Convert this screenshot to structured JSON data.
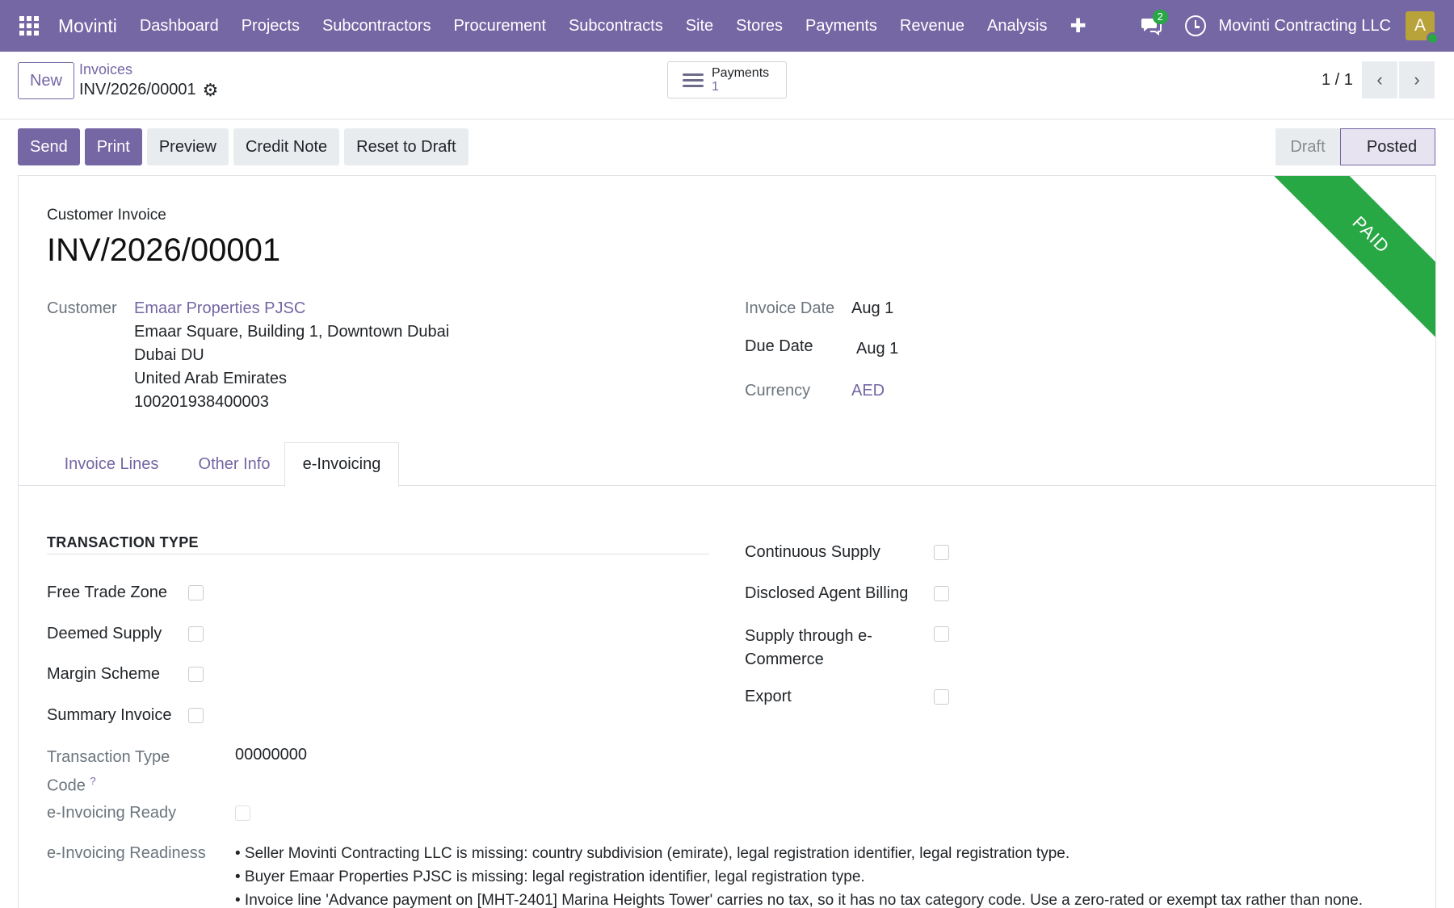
{
  "navbar": {
    "brand": "Movinti",
    "menu": [
      "Dashboard",
      "Projects",
      "Subcontractors",
      "Procurement",
      "Subcontracts",
      "Site",
      "Stores",
      "Payments",
      "Revenue",
      "Analysis"
    ],
    "plus": "✚",
    "chat_count": "2",
    "company": "Movinti Contracting LLC",
    "avatar_initial": "A"
  },
  "control": {
    "new_label": "New",
    "breadcrumb_parent": "Invoices",
    "breadcrumb_current": "INV/2026/00001",
    "payments_label": "Payments",
    "payments_count": "1",
    "pager": "1 / 1"
  },
  "actions": [
    "Send",
    "Print",
    "Preview",
    "Credit Note",
    "Reset to Draft"
  ],
  "status": {
    "draft": "Draft",
    "posted": "Posted"
  },
  "invoice": {
    "ribbon": "PAID",
    "type": "Customer Invoice",
    "number": "INV/2026/00001",
    "customer_label": "Customer",
    "customer_name": "Emaar Properties PJSC",
    "address": [
      "Emaar Square, Building 1, Downtown Dubai",
      "Dubai DU",
      "United Arab Emirates",
      "100201938400003"
    ],
    "invoice_date_label": "Invoice Date",
    "invoice_date": "Aug 1",
    "due_date_label": "Due Date",
    "due_date": "Aug 1",
    "currency_label": "Currency",
    "currency": "AED"
  },
  "tabs": [
    "Invoice Lines",
    "Other Info",
    "e-Invoicing"
  ],
  "einvoicing": {
    "section_title": "TRANSACTION TYPE",
    "left_checks": [
      "Free Trade Zone",
      "Deemed Supply",
      "Margin Scheme",
      "Summary Invoice"
    ],
    "right_checks": [
      "Continuous Supply",
      "Disclosed Agent Billing",
      "Supply through e-Commerce",
      "Export"
    ],
    "code_label": "Transaction Type Code",
    "code_help": "?",
    "code_value": "00000000",
    "ready_label": "e-Invoicing Ready",
    "readiness_label": "e-Invoicing Readiness",
    "readiness": [
      "• Seller Movinti Contracting LLC is missing: country subdivision (emirate), legal registration identifier, legal registration type.",
      "• Buyer Emaar Properties PJSC is missing: legal registration identifier, legal registration type.",
      "• Invoice line 'Advance payment on [MHT-2401] Marina Heights Tower' carries no tax, so it has no tax category code. Use a zero-rated or exempt tax rather than none."
    ]
  },
  "colors": {
    "brand": "#7566a4",
    "paid": "#28a745"
  }
}
